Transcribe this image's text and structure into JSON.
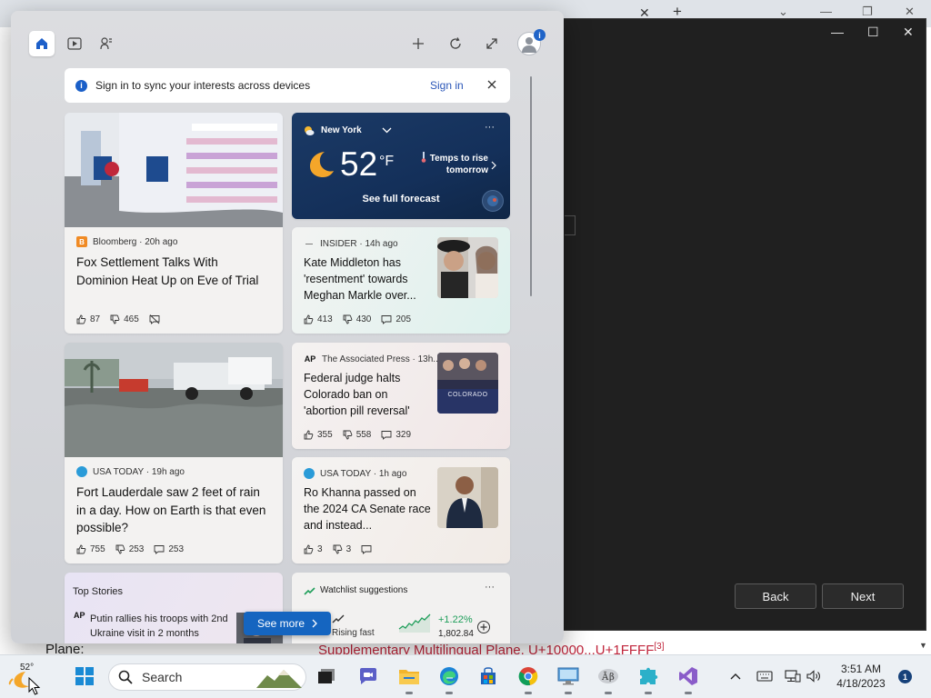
{
  "background_page": {
    "bottom_left_text": "Plane:",
    "bottom_right_text": "Supplementary Multilingual Plane, U+10000...U+1FFFF",
    "superscript": "[3]"
  },
  "dialog": {
    "back_label": "Back",
    "next_label": "Next"
  },
  "signin_bar": {
    "message": "Sign in to sync your interests across devices",
    "link": "Sign in"
  },
  "weather": {
    "location": "New York",
    "temperature": "52",
    "unit": "°F",
    "hint": "Temps to rise tomorrow",
    "forecast_link": "See full forecast",
    "more": "···"
  },
  "cards": [
    {
      "source": "Bloomberg · 20h ago",
      "headline": "Fox Settlement Talks With Dominion Heat Up on Eve of Trial",
      "likes": "87",
      "dislikes": "465"
    },
    {
      "source": "INSIDER · 14h ago",
      "headline": "Kate Middleton has 'resentment' towards Meghan Markle over...",
      "likes": "413",
      "dislikes": "430",
      "comments": "205"
    },
    {
      "source": "USA TODAY · 19h ago",
      "headline": "Fort Lauderdale saw 2 feet of rain in a day. How on Earth is that even possible?",
      "likes": "755",
      "dislikes": "253",
      "comments": "253"
    },
    {
      "source": "The Associated Press · 13h...",
      "source_logo": "AP",
      "headline": "Federal judge halts Colorado ban on 'abortion pill reversal'",
      "likes": "355",
      "dislikes": "558",
      "comments": "329",
      "thumb_text": "COLORADO"
    },
    {
      "source": "USA TODAY · 1h ago",
      "headline": "Ro Khanna passed on the 2024 CA Senate race and instead...",
      "likes": "3",
      "dislikes": "3"
    }
  ],
  "top_stories": {
    "title": "Top Stories",
    "item_logo": "AP",
    "item_text": "Putin rallies his troops with 2nd Ukraine visit in 2 months"
  },
  "watchlist": {
    "title": "Watchlist suggestions",
    "more": "···",
    "label": "Rising fast",
    "change": "+1.22%",
    "value": "1,802.84"
  },
  "see_more": "See more",
  "taskbar": {
    "weather_temp": "52°",
    "search_label": "Search",
    "time": "3:51 AM",
    "date": "4/18/2023",
    "notification_count": "1"
  },
  "colors": {
    "accent": "#1565c0",
    "weather_bg": "#1b3a66",
    "dark_dialog": "#202020"
  }
}
